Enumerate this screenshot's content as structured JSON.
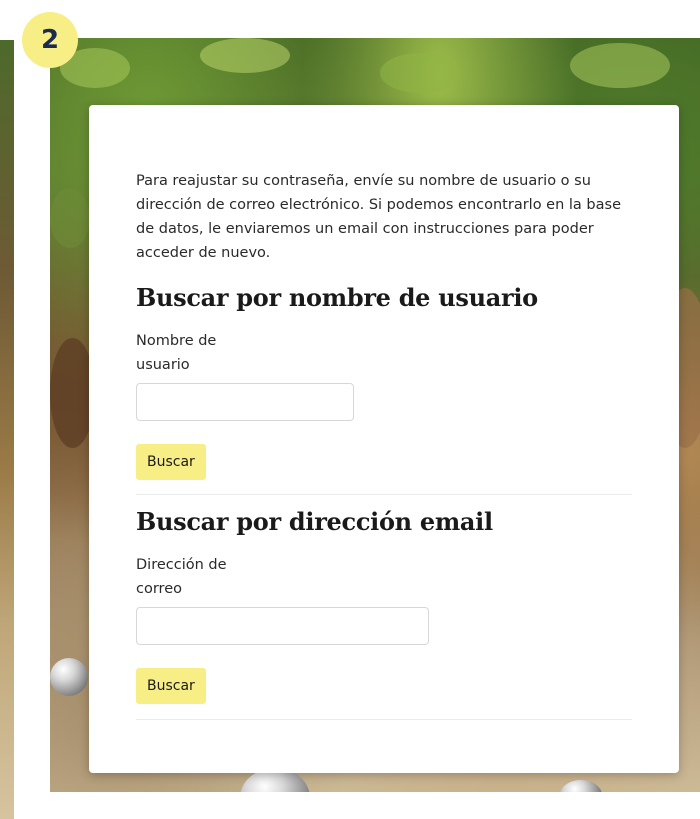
{
  "step_badge": "2",
  "intro_text": "Para reajustar su contraseña, envíe su nombre de usuario o su dirección de correo electrónico. Si podemos encontrarlo en la base de datos, le enviaremos un email con instrucciones para poder acceder de nuevo.",
  "username_section": {
    "title": "Buscar por nombre de usuario",
    "label": "Nombre de usuario",
    "input_value": "",
    "button_label": "Buscar"
  },
  "email_section": {
    "title": "Buscar por dirección email",
    "label": "Dirección de correo",
    "input_value": "",
    "button_label": "Buscar"
  },
  "colors": {
    "badge": "#f7ef86",
    "badge_text": "#1c2a52",
    "button": "#f7ef86",
    "card": "#ffffff"
  }
}
